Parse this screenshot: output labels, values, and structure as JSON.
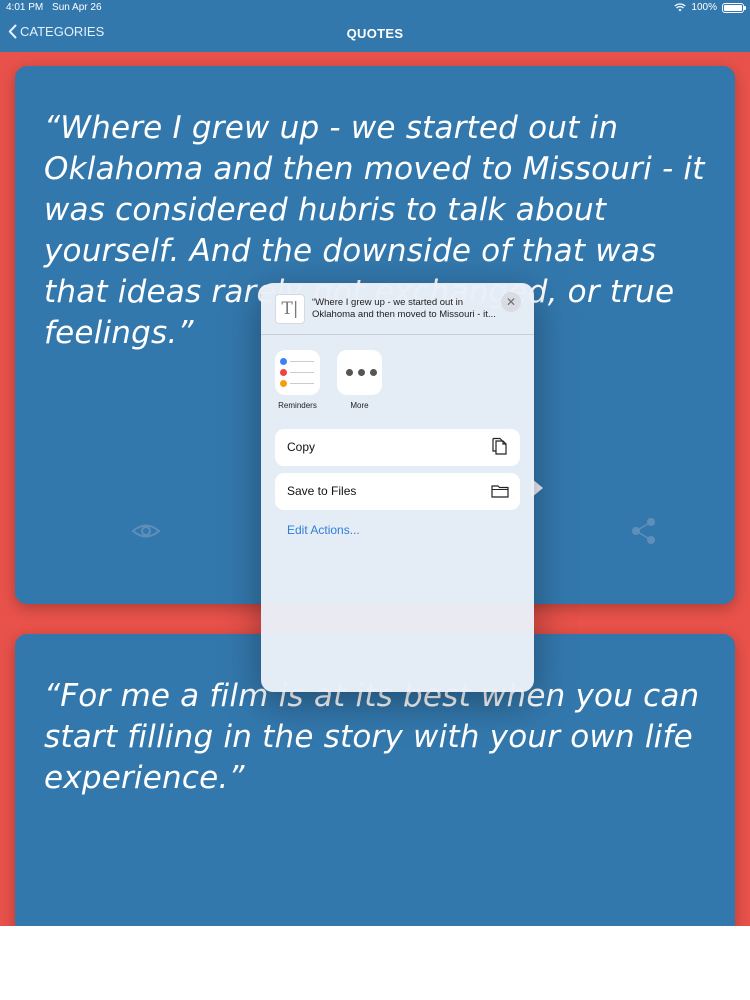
{
  "status_bar": {
    "time": "4:01 PM",
    "date": "Sun Apr 26",
    "battery": "100%"
  },
  "nav": {
    "back_label": "CATEGORIES",
    "title": "QUOTES"
  },
  "cards": [
    {
      "quote": "“Where I grew up - we started out in Oklahoma and then moved to Missouri - it was considered hubris to talk about yourself. And the downside of that was that ideas rarely got exchanged, or true feelings.”"
    },
    {
      "quote": "“For me a film is at its best when you can start filling in the story with your own life experience.”"
    }
  ],
  "share_sheet": {
    "preview_text": "“Where I grew up - we started out in Oklahoma and then moved to Missouri - it...",
    "doc_glyph": "T|",
    "close_glyph": "✕",
    "apps": [
      {
        "label": "Reminders",
        "icon": "reminders-icon"
      },
      {
        "label": "More",
        "icon": "more-icon"
      }
    ],
    "actions": [
      {
        "label": "Copy",
        "icon": "copy-icon"
      },
      {
        "label": "Save to Files",
        "icon": "folder-icon"
      }
    ],
    "edit_actions_label": "Edit Actions..."
  },
  "colors": {
    "background": "#e8524a",
    "card": "#3378ad",
    "link": "#2f7fd6"
  }
}
